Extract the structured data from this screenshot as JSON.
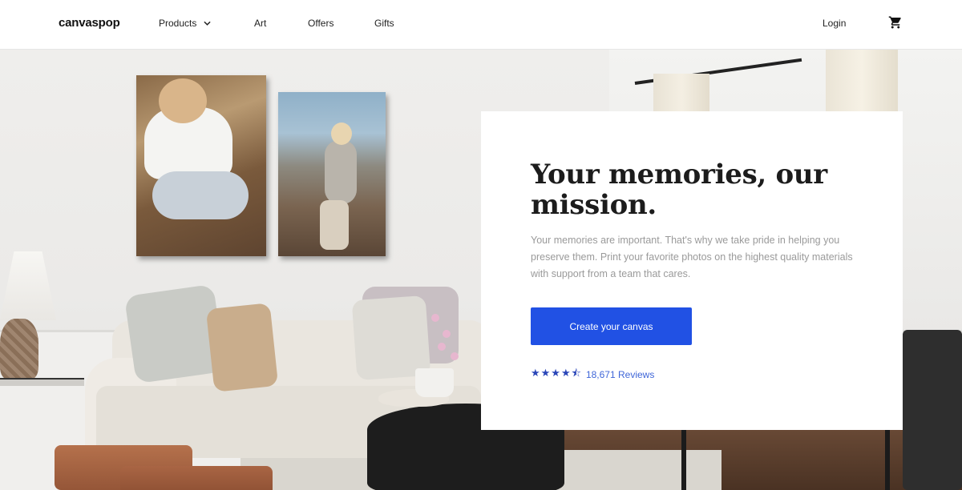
{
  "header": {
    "logo": "canvaspop",
    "nav": {
      "products": "Products",
      "art": "Art",
      "offers": "Offers",
      "gifts": "Gifts"
    },
    "login": "Login",
    "cart_icon": "cart-icon"
  },
  "hero": {
    "headline": "Your memories, our mission.",
    "body": "Your memories are important. That's why we take pride in helping you preserve them. Print your favorite photos on the highest quality materials with support from a team that cares.",
    "cta_label": "Create your canvas",
    "rating": {
      "stars": "★★★★⯪",
      "value": 4.5,
      "reviews_label": "18,671 Reviews"
    }
  },
  "colors": {
    "accent": "#2151e4",
    "star": "#2a46b8",
    "link": "#3f66d8"
  }
}
